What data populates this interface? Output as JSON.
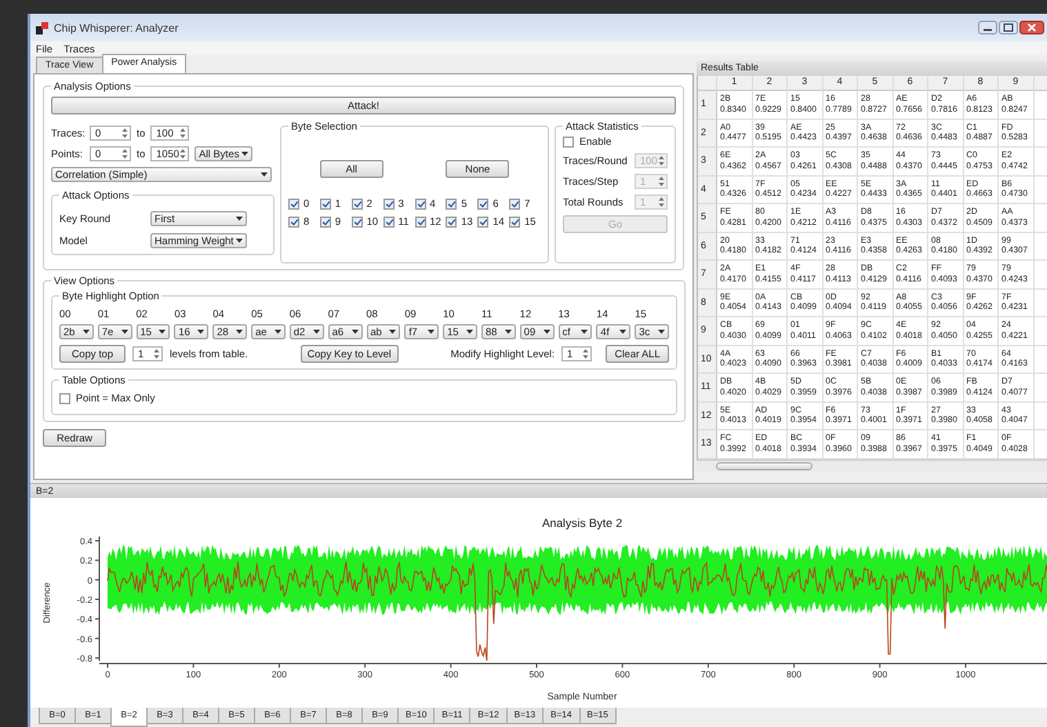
{
  "window": {
    "title": "Chip Whisperer: Analyzer"
  },
  "menu": [
    "File",
    "Traces"
  ],
  "tabs": [
    {
      "label": "Trace View",
      "selected": false
    },
    {
      "label": "Power Analysis",
      "selected": true
    }
  ],
  "analysis_options": {
    "title": "Analysis Options",
    "attack_button": "Attack!",
    "traces": {
      "label": "Traces:",
      "from": "0",
      "to_label": "to",
      "to": "100"
    },
    "points": {
      "label": "Points:",
      "from": "0",
      "to_label": "to",
      "to": "1050",
      "mode": "All Bytes"
    },
    "algorithm": "Correlation (Simple)",
    "attack_options": {
      "title": "Attack Options",
      "fields": [
        {
          "label": "Key Round",
          "value": "First"
        },
        {
          "label": "Model",
          "value": "Hamming Weight"
        }
      ]
    },
    "byte_selection": {
      "title": "Byte Selection",
      "all_button": "All",
      "none_button": "None",
      "bytes": [
        {
          "label": "0",
          "checked": true
        },
        {
          "label": "1",
          "checked": true
        },
        {
          "label": "2",
          "checked": true
        },
        {
          "label": "3",
          "checked": true
        },
        {
          "label": "4",
          "checked": true
        },
        {
          "label": "5",
          "checked": true
        },
        {
          "label": "6",
          "checked": true
        },
        {
          "label": "7",
          "checked": true
        },
        {
          "label": "8",
          "checked": true
        },
        {
          "label": "9",
          "checked": true
        },
        {
          "label": "10",
          "checked": true
        },
        {
          "label": "11",
          "checked": true
        },
        {
          "label": "12",
          "checked": true
        },
        {
          "label": "13",
          "checked": true
        },
        {
          "label": "14",
          "checked": true
        },
        {
          "label": "15",
          "checked": true
        }
      ]
    },
    "attack_statistics": {
      "title": "Attack Statistics",
      "enable": {
        "label": "Enable",
        "checked": false
      },
      "fields": [
        {
          "label": "Traces/Round",
          "value": "100",
          "disabled": true
        },
        {
          "label": "Traces/Step",
          "value": "1",
          "disabled": true
        },
        {
          "label": "Total Rounds",
          "value": "1",
          "disabled": true
        }
      ],
      "go_button": {
        "label": "Go",
        "disabled": true
      }
    }
  },
  "view_options": {
    "title": "View Options",
    "byte_highlight": {
      "title": "Byte Highlight Option",
      "bytes": [
        {
          "index": "00",
          "value": "2b"
        },
        {
          "index": "01",
          "value": "7e"
        },
        {
          "index": "02",
          "value": "15"
        },
        {
          "index": "03",
          "value": "16"
        },
        {
          "index": "04",
          "value": "28"
        },
        {
          "index": "05",
          "value": "ae"
        },
        {
          "index": "06",
          "value": "d2"
        },
        {
          "index": "07",
          "value": "a6"
        },
        {
          "index": "08",
          "value": "ab"
        },
        {
          "index": "09",
          "value": "f7"
        },
        {
          "index": "10",
          "value": "15"
        },
        {
          "index": "11",
          "value": "88"
        },
        {
          "index": "12",
          "value": "09"
        },
        {
          "index": "13",
          "value": "cf"
        },
        {
          "index": "14",
          "value": "4f"
        },
        {
          "index": "15",
          "value": "3c"
        }
      ],
      "copy_top": "Copy top",
      "levels": "1",
      "levels_text": "levels from table.",
      "copy_key": "Copy Key to Level",
      "modify_label": "Modify Highlight Level:",
      "modify_value": "1",
      "clear": "Clear ALL"
    },
    "table_options": {
      "title": "Table Options",
      "point_max": {
        "label": "Point = Max Only",
        "checked": false
      }
    },
    "redraw": "Redraw"
  },
  "results": {
    "title": "Results Table",
    "columns": [
      "1",
      "2",
      "3",
      "4",
      "5",
      "6",
      "7",
      "8",
      "9"
    ],
    "rows": [
      {
        "label": "1",
        "cells": [
          [
            "2B",
            "0.8340"
          ],
          [
            "7E",
            "0.9229"
          ],
          [
            "15",
            "0.8400"
          ],
          [
            "16",
            "0.7789"
          ],
          [
            "28",
            "0.8727"
          ],
          [
            "AE",
            "0.7656"
          ],
          [
            "D2",
            "0.7816"
          ],
          [
            "A6",
            "0.8123"
          ],
          [
            "AB",
            "0.8247"
          ]
        ]
      },
      {
        "label": "2",
        "cells": [
          [
            "A0",
            "0.4477"
          ],
          [
            "39",
            "0.5195"
          ],
          [
            "AE",
            "0.4423"
          ],
          [
            "25",
            "0.4397"
          ],
          [
            "3A",
            "0.4638"
          ],
          [
            "72",
            "0.4636"
          ],
          [
            "3C",
            "0.4483"
          ],
          [
            "C1",
            "0.4887"
          ],
          [
            "FD",
            "0.5283"
          ]
        ]
      },
      {
        "label": "3",
        "cells": [
          [
            "6E",
            "0.4362"
          ],
          [
            "2A",
            "0.4567"
          ],
          [
            "03",
            "0.4261"
          ],
          [
            "5C",
            "0.4308"
          ],
          [
            "35",
            "0.4488"
          ],
          [
            "44",
            "0.4370"
          ],
          [
            "73",
            "0.4445"
          ],
          [
            "C0",
            "0.4753"
          ],
          [
            "E2",
            "0.4742"
          ]
        ]
      },
      {
        "label": "4",
        "cells": [
          [
            "51",
            "0.4326"
          ],
          [
            "7F",
            "0.4512"
          ],
          [
            "05",
            "0.4234"
          ],
          [
            "EE",
            "0.4227"
          ],
          [
            "5E",
            "0.4433"
          ],
          [
            "3A",
            "0.4365"
          ],
          [
            "11",
            "0.4401"
          ],
          [
            "ED",
            "0.4663"
          ],
          [
            "B6",
            "0.4730"
          ]
        ]
      },
      {
        "label": "5",
        "cells": [
          [
            "FE",
            "0.4281"
          ],
          [
            "80",
            "0.4200"
          ],
          [
            "1E",
            "0.4212"
          ],
          [
            "A3",
            "0.4116"
          ],
          [
            "D8",
            "0.4375"
          ],
          [
            "16",
            "0.4303"
          ],
          [
            "D7",
            "0.4372"
          ],
          [
            "2D",
            "0.4509"
          ],
          [
            "AA",
            "0.4373"
          ]
        ]
      },
      {
        "label": "6",
        "cells": [
          [
            "20",
            "0.4180"
          ],
          [
            "33",
            "0.4182"
          ],
          [
            "71",
            "0.4124"
          ],
          [
            "23",
            "0.4116"
          ],
          [
            "E3",
            "0.4358"
          ],
          [
            "EE",
            "0.4263"
          ],
          [
            "08",
            "0.4180"
          ],
          [
            "1D",
            "0.4392"
          ],
          [
            "99",
            "0.4307"
          ]
        ]
      },
      {
        "label": "7",
        "cells": [
          [
            "2A",
            "0.4170"
          ],
          [
            "E1",
            "0.4155"
          ],
          [
            "4F",
            "0.4117"
          ],
          [
            "28",
            "0.4113"
          ],
          [
            "DB",
            "0.4129"
          ],
          [
            "C2",
            "0.4116"
          ],
          [
            "FF",
            "0.4093"
          ],
          [
            "79",
            "0.4370"
          ],
          [
            "79",
            "0.4243"
          ]
        ]
      },
      {
        "label": "8",
        "cells": [
          [
            "9E",
            "0.4054"
          ],
          [
            "0A",
            "0.4143"
          ],
          [
            "CB",
            "0.4099"
          ],
          [
            "0D",
            "0.4094"
          ],
          [
            "92",
            "0.4119"
          ],
          [
            "A8",
            "0.4055"
          ],
          [
            "C3",
            "0.4056"
          ],
          [
            "9F",
            "0.4262"
          ],
          [
            "7F",
            "0.4231"
          ]
        ]
      },
      {
        "label": "9",
        "cells": [
          [
            "CB",
            "0.4030"
          ],
          [
            "69",
            "0.4099"
          ],
          [
            "01",
            "0.4011"
          ],
          [
            "9F",
            "0.4063"
          ],
          [
            "9C",
            "0.4102"
          ],
          [
            "4E",
            "0.4018"
          ],
          [
            "92",
            "0.4050"
          ],
          [
            "04",
            "0.4255"
          ],
          [
            "24",
            "0.4221"
          ]
        ]
      },
      {
        "label": "10",
        "cells": [
          [
            "4A",
            "0.4023"
          ],
          [
            "63",
            "0.4090"
          ],
          [
            "66",
            "0.3963"
          ],
          [
            "FE",
            "0.3981"
          ],
          [
            "C7",
            "0.4038"
          ],
          [
            "F6",
            "0.4009"
          ],
          [
            "B1",
            "0.4033"
          ],
          [
            "70",
            "0.4174"
          ],
          [
            "64",
            "0.4163"
          ]
        ]
      },
      {
        "label": "11",
        "cells": [
          [
            "DB",
            "0.4020"
          ],
          [
            "4B",
            "0.4029"
          ],
          [
            "5D",
            "0.3959"
          ],
          [
            "0C",
            "0.3976"
          ],
          [
            "5B",
            "0.4038"
          ],
          [
            "0E",
            "0.3987"
          ],
          [
            "06",
            "0.3989"
          ],
          [
            "FB",
            "0.4124"
          ],
          [
            "D7",
            "0.4077"
          ]
        ]
      },
      {
        "label": "12",
        "cells": [
          [
            "5E",
            "0.4013"
          ],
          [
            "AD",
            "0.4019"
          ],
          [
            "9C",
            "0.3954"
          ],
          [
            "F6",
            "0.3971"
          ],
          [
            "73",
            "0.4001"
          ],
          [
            "1F",
            "0.3971"
          ],
          [
            "27",
            "0.3980"
          ],
          [
            "33",
            "0.4058"
          ],
          [
            "43",
            "0.4047"
          ]
        ]
      },
      {
        "label": "13",
        "cells": [
          [
            "FC",
            "0.3992"
          ],
          [
            "ED",
            "0.4018"
          ],
          [
            "BC",
            "0.3934"
          ],
          [
            "0F",
            "0.3960"
          ],
          [
            "09",
            "0.3988"
          ],
          [
            "86",
            "0.3967"
          ],
          [
            "41",
            "0.3975"
          ],
          [
            "F1",
            "0.4049"
          ],
          [
            "0F",
            "0.4028"
          ]
        ]
      }
    ]
  },
  "plot_dock": {
    "title": "B=2",
    "plot": {
      "title": "Analysis Byte 2",
      "xlabel": "Sample Number",
      "ylabel": "Difference",
      "xticks": [
        "0",
        "100",
        "200",
        "300",
        "400",
        "500",
        "600",
        "700",
        "800",
        "900",
        "1000"
      ],
      "yticks": [
        "0.4",
        "0.2",
        "0",
        "-0.2",
        "-0.4",
        "-0.6",
        "-0.8"
      ]
    },
    "tabs": [
      {
        "label": "B=0",
        "selected": false
      },
      {
        "label": "B=1",
        "selected": false
      },
      {
        "label": "B=2",
        "selected": true
      },
      {
        "label": "B=3",
        "selected": false
      },
      {
        "label": "B=4",
        "selected": false
      },
      {
        "label": "B=5",
        "selected": false
      },
      {
        "label": "B=6",
        "selected": false
      },
      {
        "label": "B=7",
        "selected": false
      },
      {
        "label": "B=8",
        "selected": false
      },
      {
        "label": "B=9",
        "selected": false
      },
      {
        "label": "B=10",
        "selected": false
      },
      {
        "label": "B=11",
        "selected": false
      },
      {
        "label": "B=12",
        "selected": false
      },
      {
        "label": "B=13",
        "selected": false
      },
      {
        "label": "B=14",
        "selected": false
      },
      {
        "label": "B=15",
        "selected": false
      }
    ]
  }
}
